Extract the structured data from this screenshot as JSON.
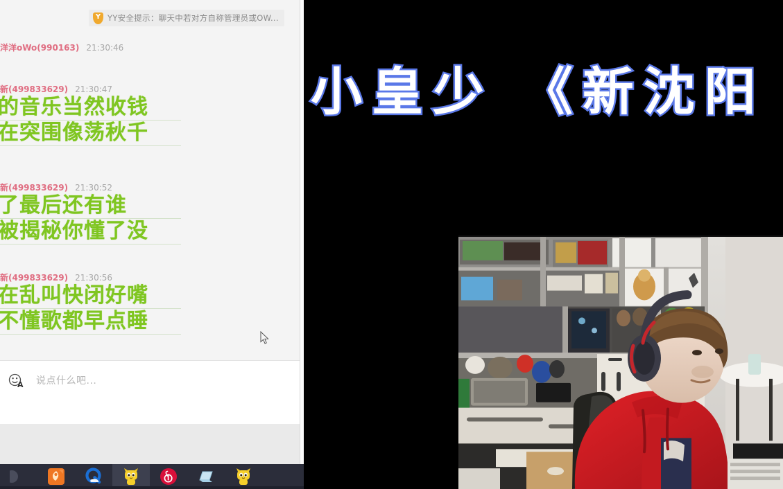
{
  "app": {
    "name": "YY Live Chat",
    "window_title": "YY"
  },
  "chat": {
    "safety_banner": {
      "icon": "shield-icon",
      "badge_letter": "Y",
      "text": "YY安全提示：聊天中若对方自称管理员或OW..."
    },
    "messages": [
      {
        "nick": "洋洋oWo(990163)",
        "time": "21:30:46",
        "lines": []
      },
      {
        "nick": "新(499833629)",
        "time": "21:30:47",
        "lines": [
          "们的音乐当然收钱",
          "奏在突围像荡秋千"
        ]
      },
      {
        "nick": "新(499833629)",
        "time": "21:30:52",
        "lines": [
          "到了最后还有谁",
          "案被揭秘你懂了没"
        ]
      },
      {
        "nick": "新(499833629)",
        "time": "21:30:56",
        "lines": [
          "鸨在乱叫快闭好嘴",
          "哥不懂歌都早点睡"
        ]
      }
    ],
    "input": {
      "emoji_icon": "emoji-font-icon",
      "placeholder": "说点什么吧..."
    },
    "colors": {
      "message_green": "#7fc621",
      "nickname_pink": "#e06e82",
      "timestamp_grey": "#a8a8a8",
      "panel_background": "#f4f4f4"
    }
  },
  "cursor": {
    "icon": "mouse-pointer-icon"
  },
  "taskbar": {
    "background": "#2b2d3a",
    "items": [
      {
        "icon": "partial-circle-icon",
        "label": ""
      },
      {
        "icon": "orange-app-icon",
        "label": "",
        "active": false
      },
      {
        "icon": "qq-browser-icon",
        "label": "",
        "active": false
      },
      {
        "icon": "yy-bear-icon",
        "label": "",
        "active": true
      },
      {
        "icon": "netease-music-icon",
        "label": "",
        "active": false
      },
      {
        "icon": "blue-folder-icon",
        "label": "",
        "active": false
      },
      {
        "icon": "yy-bear-icon",
        "label": "",
        "active": false
      }
    ]
  },
  "stream_overlay": {
    "title": "小皇少 《新沈阳",
    "title_fill_color": "#ffffff",
    "title_outline_color": "#5b79e8",
    "background_color": "#000000"
  },
  "webcam": {
    "caption": "streamer-webcam-feed",
    "description": "Person in red hoodie with red headphones at a desk with shelving",
    "colors": {
      "hoodie": "#d21f26",
      "headphones": "#3a3a46",
      "wall": "#d8d6d2",
      "desk": "#cfc9bf"
    }
  }
}
